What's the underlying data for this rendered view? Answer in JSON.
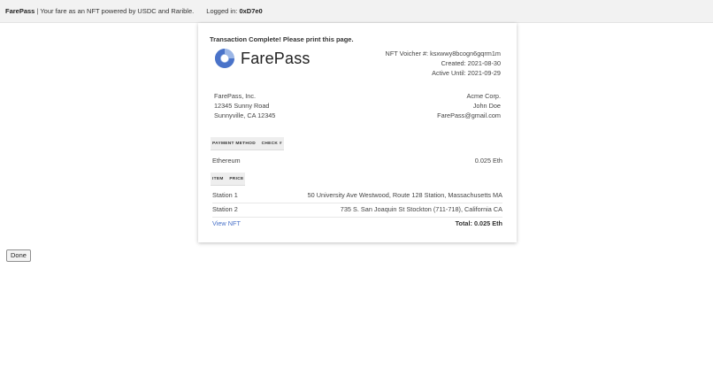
{
  "header": {
    "brand": "FarePass",
    "separator": "|",
    "tagline": "Your fare as an NFT powered by USDC and Rarible.",
    "login_label": "Logged in:",
    "login_user": "0xD7e0"
  },
  "receipt": {
    "status": "Transaction Complete! Please print this page.",
    "logo_text": "FarePass",
    "voucher_line": "NFT Voicher #: ksxwwy8bcogn6gqrm1m",
    "created_line": "Created: 2021-08-30",
    "active_line": "Active Until: 2021-09-29",
    "from": {
      "name": "FarePass, Inc.",
      "street": "12345 Sunny Road",
      "city": "Sunnyville, CA 12345"
    },
    "to": {
      "company": "Acme Corp.",
      "person": "John Doe",
      "email": "FarePass@gmail.com"
    },
    "payment_header": [
      "PAYMENT METHOD",
      "CHECK #"
    ],
    "payment": {
      "method": "Ethereum",
      "amount": "0.025 Eth"
    },
    "items_header": [
      "ITEM",
      "PRICE"
    ],
    "items": [
      {
        "item": "Station 1",
        "price": "50 University Ave Westwood, Route 128 Station, Massachusetts MA"
      },
      {
        "item": "Station 2",
        "price": "735 S. San Joaquin St Stockton (711-718), California CA"
      }
    ],
    "view_nft_label": "View NFT",
    "total": "Total: 0.025 Eth"
  },
  "done_label": "Done",
  "colors": {
    "logo_blue": "#4a73c9",
    "logo_light": "#9bb6e6",
    "link": "#4a73c9"
  }
}
